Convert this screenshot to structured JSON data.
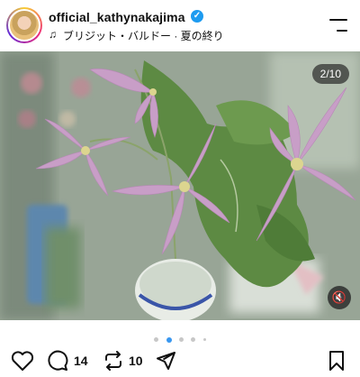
{
  "header": {
    "username": "official_kathynakajima",
    "music_icon": "music-note-icon",
    "music_label": "ブリジット・バルドー · 夏の終り",
    "verified_icon": "verified-badge-icon",
    "menu_icon": "hamburger-menu-icon"
  },
  "media": {
    "counter": "2/10",
    "mute_icon": "muted-speaker-icon",
    "carousel_total": 5,
    "carousel_active": 2
  },
  "actions": {
    "like_icon": "heart-icon",
    "comment_icon": "comment-bubble-icon",
    "comment_count": "14",
    "repost_icon": "repost-icon",
    "repost_count": "10",
    "share_icon": "paper-plane-icon",
    "save_icon": "bookmark-icon"
  },
  "colors": {
    "accent": "#3897f0",
    "verified": "#1d9bf0",
    "flower": "#c89ec7"
  }
}
